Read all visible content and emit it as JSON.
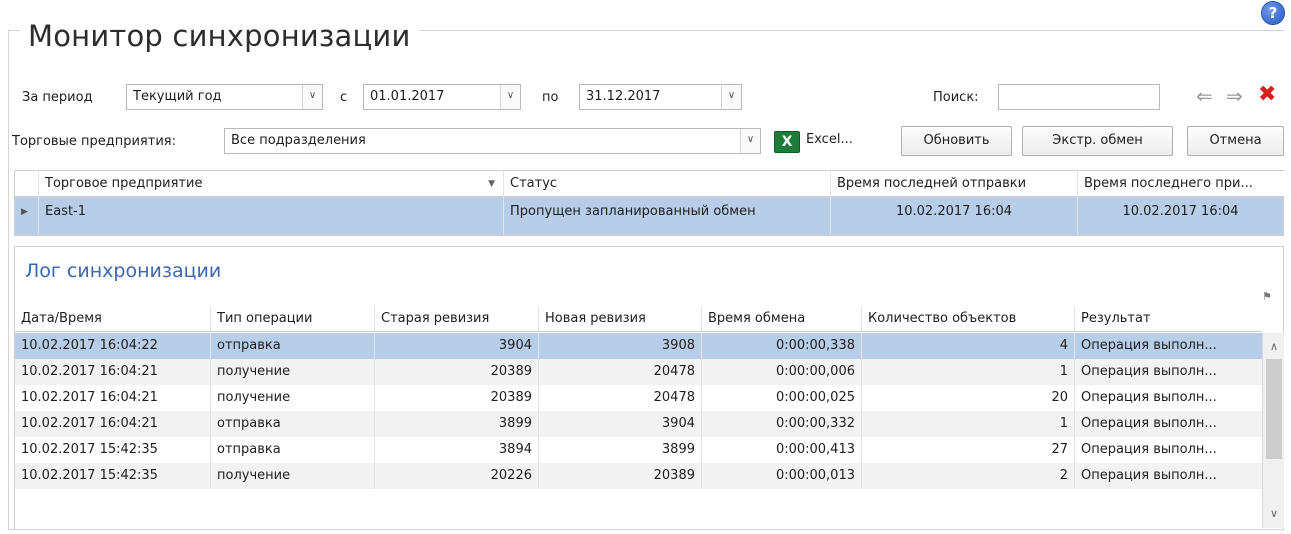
{
  "window": {
    "title": "Монитор синхронизации"
  },
  "filters": {
    "period_label": "За период",
    "period_value": "Текущий год",
    "from_label": "с",
    "from_value": "01.01.2017",
    "to_label": "по",
    "to_value": "31.12.2017",
    "search_label": "Поиск:",
    "search_value": "",
    "enterprise_label": "Торговые предприятия:",
    "enterprise_value": "Все подразделения"
  },
  "toolbar": {
    "excel_label": "Excel...",
    "refresh_label": "Обновить",
    "extra_exchange_label": "Экстр. обмен",
    "cancel_label": "Отмена"
  },
  "stores_table": {
    "columns": [
      "Торговое предприятие",
      "Статус",
      "Время последней отправки",
      "Время последнего при..."
    ],
    "rows": [
      [
        "East-1",
        "Пропущен запланированный обмен",
        "10.02.2017 16:04",
        "10.02.2017 16:04"
      ]
    ]
  },
  "log": {
    "title": "Лог синхронизации",
    "columns": [
      "Дата/Время",
      "Тип операции",
      "Старая ревизия",
      "Новая ревизия",
      "Время обмена",
      "Количество объектов",
      "Результат"
    ],
    "rows": [
      [
        "10.02.2017 16:04:22",
        "отправка",
        "3904",
        "3908",
        "0:00:00,338",
        "4",
        "Операция выполн..."
      ],
      [
        "10.02.2017 16:04:21",
        "получение",
        "20389",
        "20478",
        "0:00:00,006",
        "1",
        "Операция выполн..."
      ],
      [
        "10.02.2017 16:04:21",
        "получение",
        "20389",
        "20478",
        "0:00:00,025",
        "20",
        "Операция выполн..."
      ],
      [
        "10.02.2017 16:04:21",
        "отправка",
        "3899",
        "3904",
        "0:00:00,332",
        "1",
        "Операция выполн..."
      ],
      [
        "10.02.2017 15:42:35",
        "отправка",
        "3894",
        "3899",
        "0:00:00,413",
        "27",
        "Операция выполн..."
      ],
      [
        "10.02.2017 15:42:35",
        "получение",
        "20226",
        "20389",
        "0:00:00,013",
        "2",
        "Операция выполн..."
      ]
    ]
  },
  "icons": {
    "help": "help-icon",
    "back": "arrow-left-icon",
    "forward": "arrow-right-icon",
    "close": "close-icon",
    "excel": "excel-icon",
    "pin": "pin-icon"
  },
  "colors": {
    "selected_row": "#b8cde8",
    "log_title": "#3b68b1",
    "close": "#d62020",
    "excel": "#1e7b3a"
  }
}
